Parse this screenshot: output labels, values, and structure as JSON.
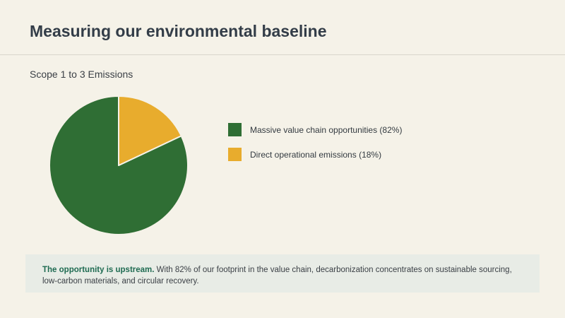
{
  "header": {
    "title": "Measuring our environmental baseline"
  },
  "chart_data": {
    "type": "pie",
    "title": "Scope 1 to 3 Emissions",
    "slices": [
      {
        "label": "Massive value chain opportunities (82%)",
        "value": 82,
        "color": "#2f6e34"
      },
      {
        "label": "Direct operational emissions (18%)",
        "value": 18,
        "color": "#e8ac2d"
      }
    ],
    "legend_position": "right"
  },
  "callout": {
    "strong": "The opportunity is upstream.",
    "text": " With 82% of our footprint in the value chain, decarbonization concentrates on sustainable sourcing, low-carbon materials, and circular recovery."
  }
}
